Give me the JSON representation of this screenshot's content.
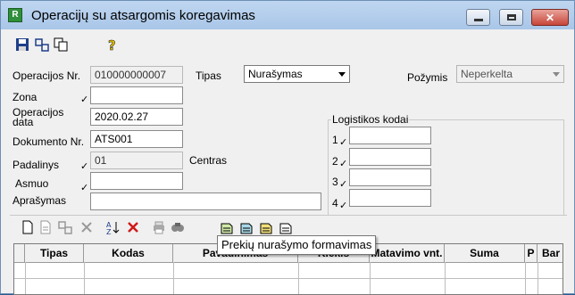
{
  "window": {
    "title": "Operacijų su atsargomis koregavimas",
    "app_icon_text": "R",
    "controls": {
      "minimize": "minimize",
      "maximize": "maximize",
      "close": "✕"
    }
  },
  "toolbar_top": {
    "icons": [
      "save-icon",
      "link-icon",
      "copy-icon",
      "help-icon"
    ]
  },
  "form": {
    "operacijos_nr": {
      "label": "Operacijos Nr.",
      "value": "010000000007"
    },
    "tipas": {
      "label": "Tipas",
      "value": "Nurašymas"
    },
    "pozymis": {
      "label": "Požymis",
      "value": "Neperkelta"
    },
    "zona": {
      "label": "Zona",
      "value": ""
    },
    "operacijos_data": {
      "label_line1": "Operacijos",
      "label_line2": "data",
      "value": "2020.02.27"
    },
    "dokumento_nr": {
      "label": "Dokumento Nr.",
      "value": "ATS001"
    },
    "padalinys": {
      "label": "Padalinys",
      "value": "01",
      "extra": "Centras"
    },
    "asmuo": {
      "label": "Asmuo",
      "value": ""
    },
    "aprasymas": {
      "label": "Aprašymas",
      "value": ""
    },
    "check_mark": "✓"
  },
  "logistics": {
    "title": "Logistikos kodai",
    "rows": [
      {
        "num": "1",
        "value": ""
      },
      {
        "num": "2",
        "value": ""
      },
      {
        "num": "3",
        "value": ""
      },
      {
        "num": "4",
        "value": ""
      }
    ]
  },
  "toolbar_grid": {
    "icons": [
      "new-doc-icon",
      "edit-doc-icon",
      "link-icon",
      "delete-icon",
      "sort-icon",
      "cancel-icon",
      "print-icon",
      "find-icon",
      "form1-icon",
      "form2-icon",
      "form3-icon",
      "form4-icon"
    ]
  },
  "tooltip": "Prekių nurašymo formavimas",
  "grid": {
    "columns": [
      "",
      "Tipas",
      "Kodas",
      "Pavadinimas",
      "Kiekis",
      "Matavimo vnt.",
      "Suma",
      "P",
      "Bar"
    ]
  },
  "colors": {
    "titlebar": "#bfd6f0",
    "close_button": "#c7453a",
    "window_bg": "#f0f0f0"
  }
}
